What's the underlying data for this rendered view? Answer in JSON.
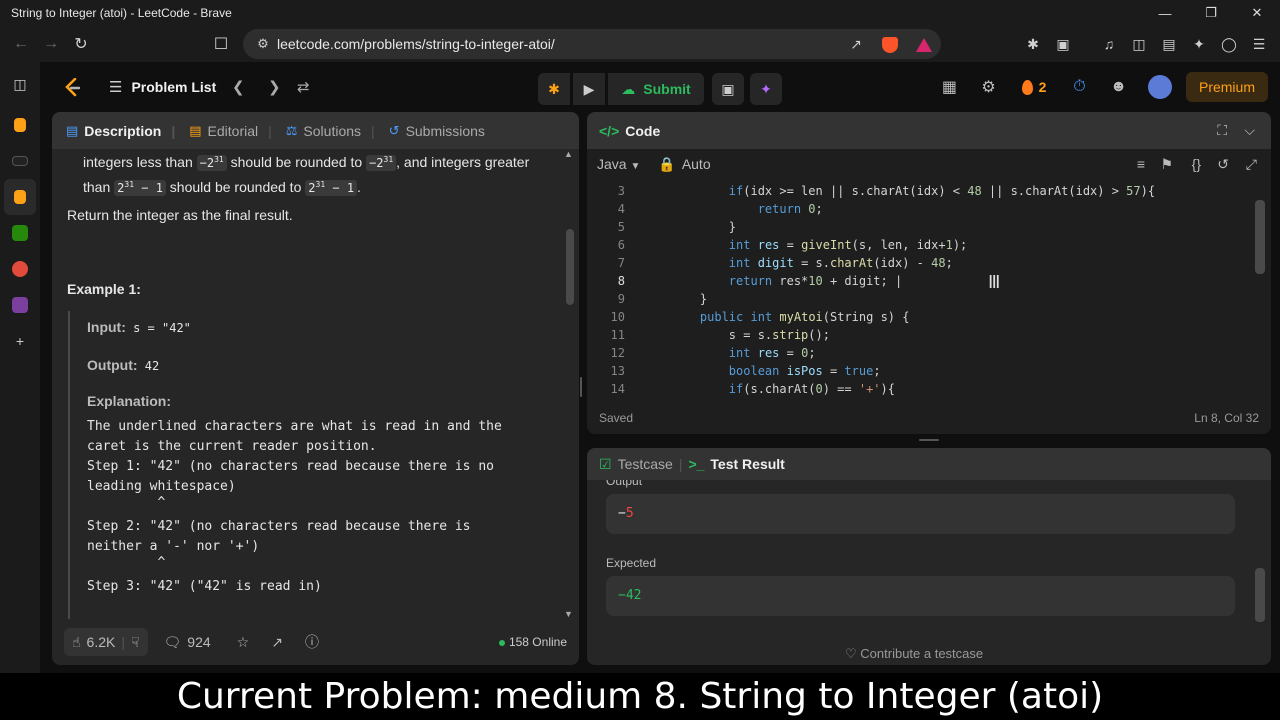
{
  "window": {
    "title": "String to Integer (atoi) - LeetCode - Brave",
    "minimize": "—",
    "restore": "❐",
    "close": "✕"
  },
  "browser": {
    "url": "leetcode.com/problems/string-to-integer-atoi/",
    "brave_badge": "5"
  },
  "topnav": {
    "problem_list": "Problem List",
    "submit_label": "Submit",
    "streak_count": "2",
    "premium_label": "Premium"
  },
  "left_panel": {
    "tabs": [
      {
        "label": "Description",
        "icon": "description-icon"
      },
      {
        "label": "Editorial",
        "icon": "book-icon"
      },
      {
        "label": "Solutions",
        "icon": "flask-icon"
      },
      {
        "label": "Submissions",
        "icon": "history-icon"
      }
    ],
    "text": {
      "p1_a": "integers less than ",
      "p1_b": "−2",
      "p1_sup": "31",
      "p1_c": " should be rounded to ",
      "p1_d": "−2",
      "p1_e": ", and integers greater",
      "p1_f": "than ",
      "p1_g": "2",
      "p1_g_tail": " − 1",
      "p1_h": " should be rounded to ",
      "p1_i": "2",
      "p1_i_tail": " − 1",
      "p1_end": ".",
      "return_text": "Return the integer as the final result.",
      "example_title": "Example 1:",
      "input_label": "Input:",
      "input_value": " s = \"42\"",
      "output_label": "Output:",
      "output_value": " 42",
      "explanation_label": "Explanation:",
      "explanation_lines": [
        "The underlined characters are what is read in and the",
        "caret is the current reader position.",
        "Step 1: \"42\" (no characters read because there is no",
        "leading whitespace)",
        "         ^",
        "",
        "Step 2: \"42\" (no characters read because there is",
        "neither a '-' nor '+')",
        "         ^",
        "",
        "Step 3: \"42\" (\"42\" is read in)"
      ]
    },
    "footer": {
      "likes": "6.2K",
      "comments": "924",
      "online": "158 Online"
    }
  },
  "code_panel": {
    "title": "Code",
    "language": "Java",
    "mode": "Auto",
    "status": "Saved",
    "cursor_pos": "Ln 8, Col 32",
    "current_line": 8,
    "lines": [
      {
        "n": "3",
        "html": "        <span class=\"k\">if</span>(idx >= len || s.charAt(idx) < <span class=\"n\">48</span> || s.charAt(idx) > <span class=\"n\">57</span>){"
      },
      {
        "n": "4",
        "html": "            <span class=\"k\">return</span> <span class=\"n\">0</span>;"
      },
      {
        "n": "5",
        "html": "        }"
      },
      {
        "n": "6",
        "html": "        <span class=\"k\">int</span> <span class=\"v\">res</span> = <span class=\"fn\">giveInt</span>(s, len, idx+<span class=\"n\">1</span>);"
      },
      {
        "n": "7",
        "html": "        <span class=\"k\">int</span> <span class=\"v\">digit</span> = s.<span class=\"fn\">charAt</span>(idx) - <span class=\"n\">48</span>;"
      },
      {
        "n": "8",
        "html": "        <span class=\"k\">return</span> res*<span class=\"n\">10</span> + digit; |"
      },
      {
        "n": "9",
        "html": "    }"
      },
      {
        "n": "10",
        "html": "    <span class=\"k\">public</span> <span class=\"k\">int</span> <span class=\"fn\">myAtoi</span>(String s) {"
      },
      {
        "n": "11",
        "html": "        s = s.<span class=\"fn\">strip</span>();"
      },
      {
        "n": "12",
        "html": "        <span class=\"k\">int</span> <span class=\"v\">res</span> = <span class=\"n\">0</span>;"
      },
      {
        "n": "13",
        "html": "        <span class=\"k\">boolean</span> <span class=\"v\">isPos</span> = <span class=\"k\">true</span>;"
      },
      {
        "n": "14",
        "html": "        <span class=\"k\">if</span>(s.charAt(<span class=\"n\">0</span>) == <span class=\"s\">'+'</span>){"
      }
    ]
  },
  "test_panel": {
    "tab_testcase": "Testcase",
    "tab_result": "Test Result",
    "output_label": "Output",
    "output_sign": "−",
    "output_value": "5",
    "expected_label": "Expected",
    "expected_value": "−42",
    "contribute": "Contribute a testcase"
  },
  "caption": "Current Problem: medium 8. String to Integer (atoi)",
  "colors": {
    "accent_green": "#2cbb5d",
    "premium_orange": "#ffa116",
    "error_red": "#ef4743"
  }
}
